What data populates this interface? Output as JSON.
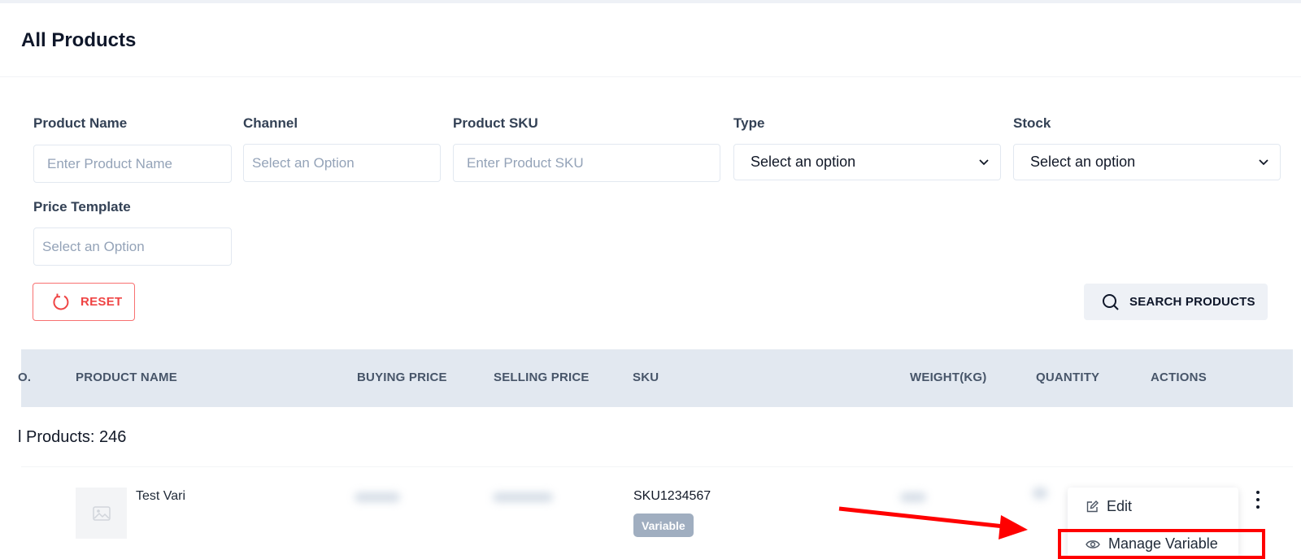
{
  "page": {
    "title": "All Products"
  },
  "filters": {
    "product_name": {
      "label": "Product Name",
      "placeholder": "Enter Product Name"
    },
    "channel": {
      "label": "Channel",
      "placeholder": "Select an Option"
    },
    "product_sku": {
      "label": "Product SKU",
      "placeholder": "Enter Product SKU"
    },
    "type": {
      "label": "Type",
      "value": "Select an option"
    },
    "stock": {
      "label": "Stock",
      "value": "Select an option"
    },
    "price_template": {
      "label": "Price Template",
      "placeholder": "Select an Option"
    }
  },
  "buttons": {
    "reset": "RESET",
    "search": "SEARCH PRODUCTS"
  },
  "table": {
    "columns": [
      "O.",
      "PRODUCT NAME",
      "BUYING PRICE",
      "SELLING PRICE",
      "SKU",
      "WEIGHT(KG)",
      "QUANTITY",
      "ACTIONS"
    ],
    "total_text": "l Products: 246",
    "rows": [
      {
        "name": "Test Vari",
        "sku": "SKU1234567",
        "badge": "Variable"
      }
    ]
  },
  "actions_menu": {
    "items": [
      "Edit",
      "Manage Variable"
    ]
  },
  "colors": {
    "accent_red": "#ef4444",
    "header_bg": "#e2e8f0",
    "badge_bg": "#a0aec0",
    "highlight": "#ff0000"
  },
  "icons": [
    "refresh-icon",
    "search-icon",
    "chevron-down-icon",
    "image-placeholder-icon",
    "kebab-icon",
    "edit-icon",
    "eye-icon"
  ]
}
